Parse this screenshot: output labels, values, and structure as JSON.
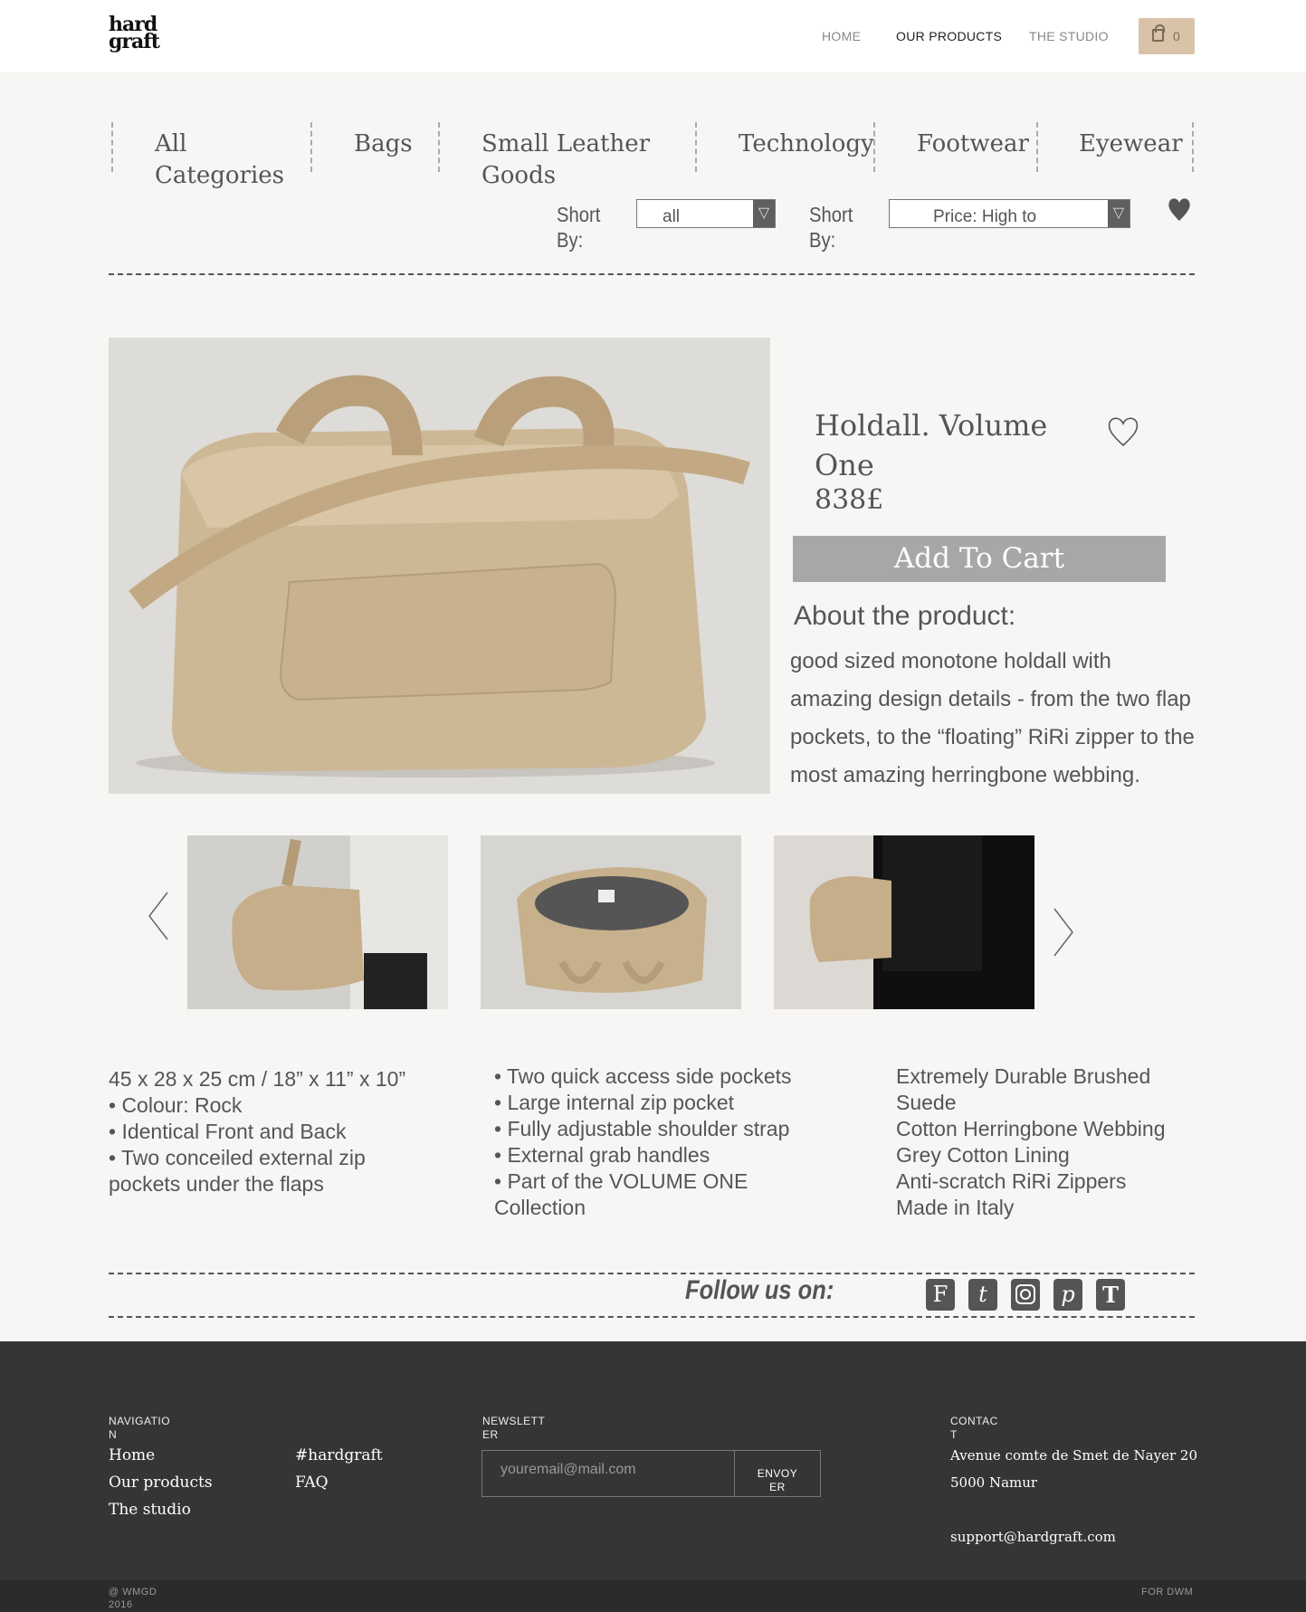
{
  "header": {
    "logo": "hard graft",
    "nav": [
      "HOME",
      "OUR PRODUCTS",
      "THE STUDIO"
    ],
    "cart_count": "0"
  },
  "categories": [
    "All Categories",
    "Bags",
    "Small Leather Goods",
    "Technology",
    "Footwear",
    "Eyewear"
  ],
  "sort": [
    {
      "label": "Short By:",
      "value": "all"
    },
    {
      "label": "Short By:",
      "value": "Price: High to"
    }
  ],
  "product": {
    "title": "Holdall. Volume One",
    "price": "838£",
    "add_to_cart": "Add To Cart",
    "about_heading": "About the product:",
    "about_text": "good sized monotone holdall with amazing design details - from the two flap pockets, to the “floating” RiRi zipper to the most amazing herringbone webbing."
  },
  "details": {
    "col1": [
      "45 x 28 x 25 cm / 18” x 11” x 10”",
      "• Colour: Rock",
      "• Identical Front and Back",
      "• Two conceiled external zip pockets under the flaps"
    ],
    "col2": [
      "• Two quick access side pockets",
      "• Large internal zip pocket",
      "• Fully adjustable shoulder strap",
      "• External grab handles",
      "• Part of the VOLUME ONE Collection"
    ],
    "col3": [
      "Extremely Durable Brushed Suede",
      "Cotton Herringbone Webbing",
      "Grey Cotton Lining",
      "Anti-scratch RiRi Zippers",
      "Made in Italy"
    ]
  },
  "follow": {
    "label": "Follow us on:",
    "icons": [
      "facebook-icon",
      "tumblr-icon",
      "instagram-icon",
      "pinterest-icon",
      "t-icon"
    ]
  },
  "footer": {
    "nav_heading": "NAVIGATION",
    "nav_links": [
      "Home",
      "Our products",
      "The studio"
    ],
    "nav_links2": [
      "#hardgraft",
      "FAQ"
    ],
    "newsletter_heading": "NEWSLETTER",
    "newsletter_placeholder": "youremail@mail.com",
    "newsletter_button": "ENVOYER",
    "contact_heading": "CONTACT",
    "address1": "Avenue comte de Smet de Nayer 20",
    "address2": "5000 Namur",
    "email": "support@hardgraft.com",
    "copyright": "@ WMGD 2016",
    "credit": "FOR DWM"
  },
  "colors": {
    "accent": "#d9c3a8",
    "footer_bg": "#353535",
    "button_gray": "#a8a7a6"
  }
}
